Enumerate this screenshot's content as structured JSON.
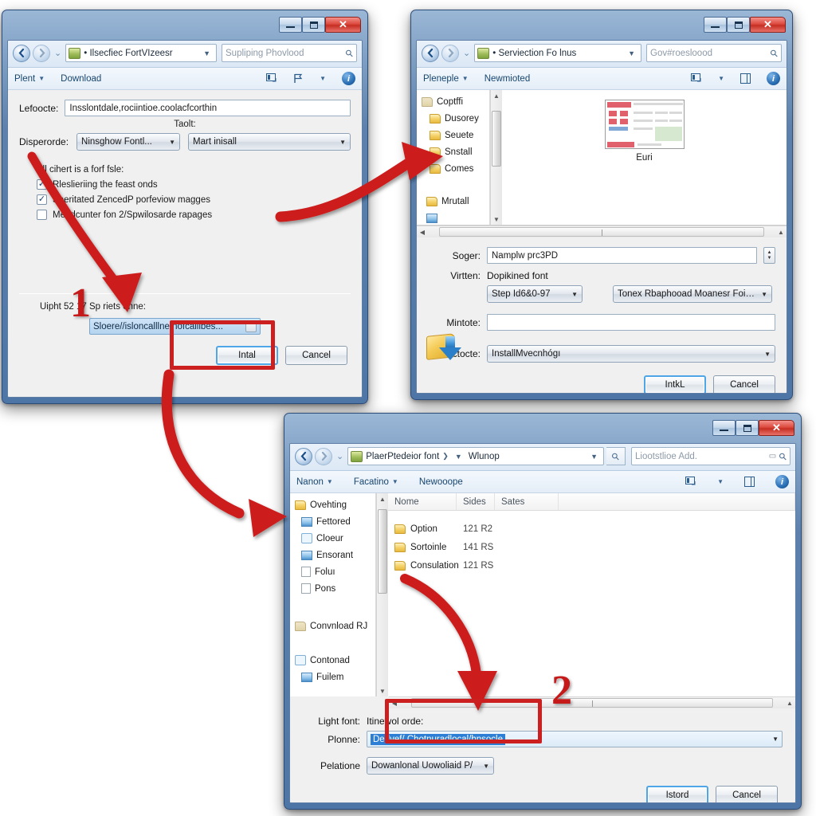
{
  "meta": {
    "accent_red": "#cc1f1f",
    "title_blue": "#4d76a6",
    "close_red": "#c62e22",
    "highlight_blue": "#3399ff"
  },
  "window1": {
    "name": "install-font-dialog",
    "titlebar": {
      "minimize": "—",
      "maximize": "□",
      "close": "✕"
    },
    "address": {
      "back": "◀",
      "forward": "▶",
      "recent_caret": "⌄",
      "breadcrumb": "• Ilsecfiec FortVIzeesr",
      "breadcrumb_caret": "▼",
      "search_placeholder": "Supliping Phovlood",
      "search_icon": "search-icon"
    },
    "toolbar": {
      "organize": "Plent",
      "organize_caret": "▼",
      "download": "Download",
      "view_icon": "view-icon",
      "share_icon": "flag-icon",
      "view_caret": "▼",
      "help": "i"
    },
    "location_label": "Lefoocte:",
    "location_value": "Insslontdale,rociintioe.coolacfcorthin",
    "tool_label": "Taolt:",
    "disperorde_label": "Disperorde:",
    "combo_left": "Ninsghow Fontl...",
    "combo_right": "Mart inisall",
    "section_label": "All cihert is a forf fsle:",
    "checkboxes": [
      {
        "label": "Rleslieriing the feast onds",
        "checked": true
      },
      {
        "label": "Speritated ZencedP porfeviow magges",
        "checked": true
      },
      {
        "label": "Mendcunter fon 2/Spwilosarde rapages",
        "checked": false
      }
    ],
    "path_label": "Uipht 52 17 Sp riets onne:",
    "path_value": "Sloere//isloncalllne.nofcalilbes...",
    "browse_button": "…",
    "install_button": "Intal",
    "cancel_button": "Cancel",
    "shield_icon": "uac-shield-folder-icon"
  },
  "window2": {
    "name": "browse-for-folder-dialog",
    "titlebar": {
      "minimize": "—",
      "maximize": "□",
      "close": "✕"
    },
    "address": {
      "back": "◀",
      "forward": "▶",
      "breadcrumb": "• Serviection Fo lnus",
      "breadcrumb_caret": "▼",
      "search_placeholder": "Gov#roesloood",
      "search_icon": "search-icon"
    },
    "toolbar": {
      "organize": "Pleneple",
      "organize_caret": "▼",
      "new_folder": "Newmioted",
      "view_icon": "view-icon",
      "view_caret": "▼",
      "pane_icon": "preview-pane-icon",
      "help": "i"
    },
    "nav_items": [
      {
        "label": "Coptffi",
        "icon": "folder-icon"
      },
      {
        "label": "Dusorey",
        "icon": "folder-icon"
      },
      {
        "label": "Seuete",
        "icon": "folder-icon"
      },
      {
        "label": "Snstall",
        "icon": "folder-icon"
      },
      {
        "label": "Comes",
        "icon": "folder-icon"
      },
      {
        "label": "",
        "icon": "spacer"
      },
      {
        "label": "Mrutall",
        "icon": "folder-icon"
      },
      {
        "label": "",
        "icon": "partial-item"
      }
    ],
    "file_item": {
      "label": "Euri",
      "icon": "file-thumbnail"
    },
    "fields": {
      "sage_label": "Soger:",
      "sage_value": "Namplw prc3PD",
      "sage_spinner": "spinner-icon",
      "virtten_label": "Virtten:",
      "virtten_value": "Dopikined font",
      "step_combo": "Step Id6&0-97",
      "type_combo": "Tonex Rbaphooad Moanesr Foitore",
      "mintote_label": "Mintote:",
      "mintote_value": "",
      "lactocte_label": "Lactocte:",
      "lactocte_value": "InstallMvecnhógı"
    },
    "install_button": "IntkL",
    "cancel_button": "Cancel",
    "shield_icon": "uac-shield-folder-icon"
  },
  "window3": {
    "name": "file-browser-dialog",
    "titlebar": {
      "minimize": "—",
      "maximize": "□",
      "close": "✕"
    },
    "address": {
      "back": "◀",
      "forward": "▶",
      "breadcrumb": "PlaerPtedeior font",
      "breadcrumb_sep": "❯",
      "breadcrumb_caret": "▼",
      "breadcrumb_2": "Wlunop",
      "dropdown_caret": "▼",
      "refresh_icon": "search-icon",
      "search_placeholder": "Liootstlioe Add.",
      "search_icon": "search-icon"
    },
    "toolbar": {
      "organize": "Nanon",
      "organize_caret": "▼",
      "arrange": "Facatino",
      "arrange_caret": "▼",
      "new": "Newooope",
      "view_icon": "view-icon",
      "view_caret": "▼",
      "pane_icon": "preview-pane-icon",
      "help": "i"
    },
    "nav_items": [
      {
        "label": "Ovehting",
        "icon": "folder-icon"
      },
      {
        "label": "Fettored",
        "icon": "picture-icon"
      },
      {
        "label": "Cloeur",
        "icon": "person-icon"
      },
      {
        "label": "Ensorant",
        "icon": "media-icon"
      },
      {
        "label": "Foluı",
        "icon": "document-icon"
      },
      {
        "label": "Pons",
        "icon": "list-icon"
      },
      {
        "label": "",
        "icon": "spacer"
      },
      {
        "label": "Convnload RJ",
        "icon": "folder-icon"
      },
      {
        "label": "",
        "icon": "spacer"
      },
      {
        "label": "Contonad",
        "icon": "network-icon"
      },
      {
        "label": "Fuilem",
        "icon": "computer-icon"
      }
    ],
    "columns": [
      "Nome",
      "Sides",
      "Sates"
    ],
    "rows": [
      {
        "name": "Option",
        "size": "121 R2",
        "status": ""
      },
      {
        "name": "Sortoinle",
        "size": "141 RS",
        "status": ""
      },
      {
        "name": "Consulation",
        "size": "121 RS",
        "status": ""
      }
    ],
    "fields": {
      "light_font_label": "Light font:",
      "light_font_value": "Itinewol orde:",
      "plonne_label": "Plonne:",
      "plonne_value": "Derlvef/ Chotnuradlocal/hnsocle",
      "pelatione_label": "Pelatione",
      "pelatione_value": "Dowanlonal Uowoliaid P/"
    },
    "install_button": "Istord",
    "cancel_button": "Cancel"
  },
  "annotations": {
    "step1": "1",
    "step2": "2",
    "arrow_color": "#cc1f1f",
    "arrows": [
      {
        "name": "arrow-checkbox-to-folder",
        "from": "window1-checkboxes",
        "to": "window2-nav-snstall"
      },
      {
        "name": "arrow-to-path-field",
        "from": "window1-combo",
        "to": "window1-path-field"
      },
      {
        "name": "arrow-to-browser-window",
        "from": "window1-path-field",
        "to": "window3-nav-pane"
      },
      {
        "name": "arrow-to-plonne-field",
        "from": "window3-file-list",
        "to": "window3-plonne-field"
      }
    ]
  }
}
